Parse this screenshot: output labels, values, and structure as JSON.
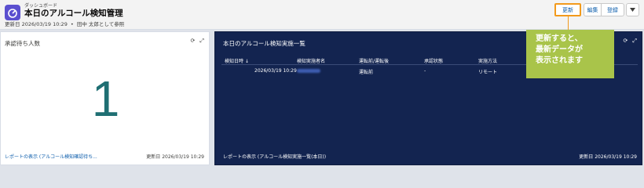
{
  "header": {
    "breadcrumb": "ダッシュボード",
    "title": "本日のアルコール検知管理",
    "updated": "更新日 2026/03/19 10:29",
    "viewing_as": "田中 太郎として参照",
    "buttons": {
      "refresh": "更新",
      "edit": "編集",
      "register": "登録"
    }
  },
  "panels": {
    "pending": {
      "title": "承認待ち人数",
      "value": "1",
      "footer_link": "レポートの表示 (アルコール検知確認待ち...",
      "footer_date": "更新日 2026/03/19 10:29"
    },
    "today": {
      "title": "本日のアルコール検知実施一覧",
      "columns": [
        "検知日時 ↓",
        "検知実施者名",
        "運転前/運転後",
        "承認状態",
        "実施方法"
      ],
      "rows": [
        {
          "date": "2026/03/19 10:29",
          "name": "",
          "timing": "運転前",
          "status": "-",
          "method": "リモート"
        }
      ],
      "footer_link": "レポートの表示 (アルコール検知実施一覧(本日))",
      "footer_date": "更新日 2026/03/19 10:29"
    }
  },
  "callout": {
    "text": "更新すると、\n最新データが\n表示されます",
    "accent_color": "#f29a1c",
    "bg_color": "#a9c44a"
  }
}
